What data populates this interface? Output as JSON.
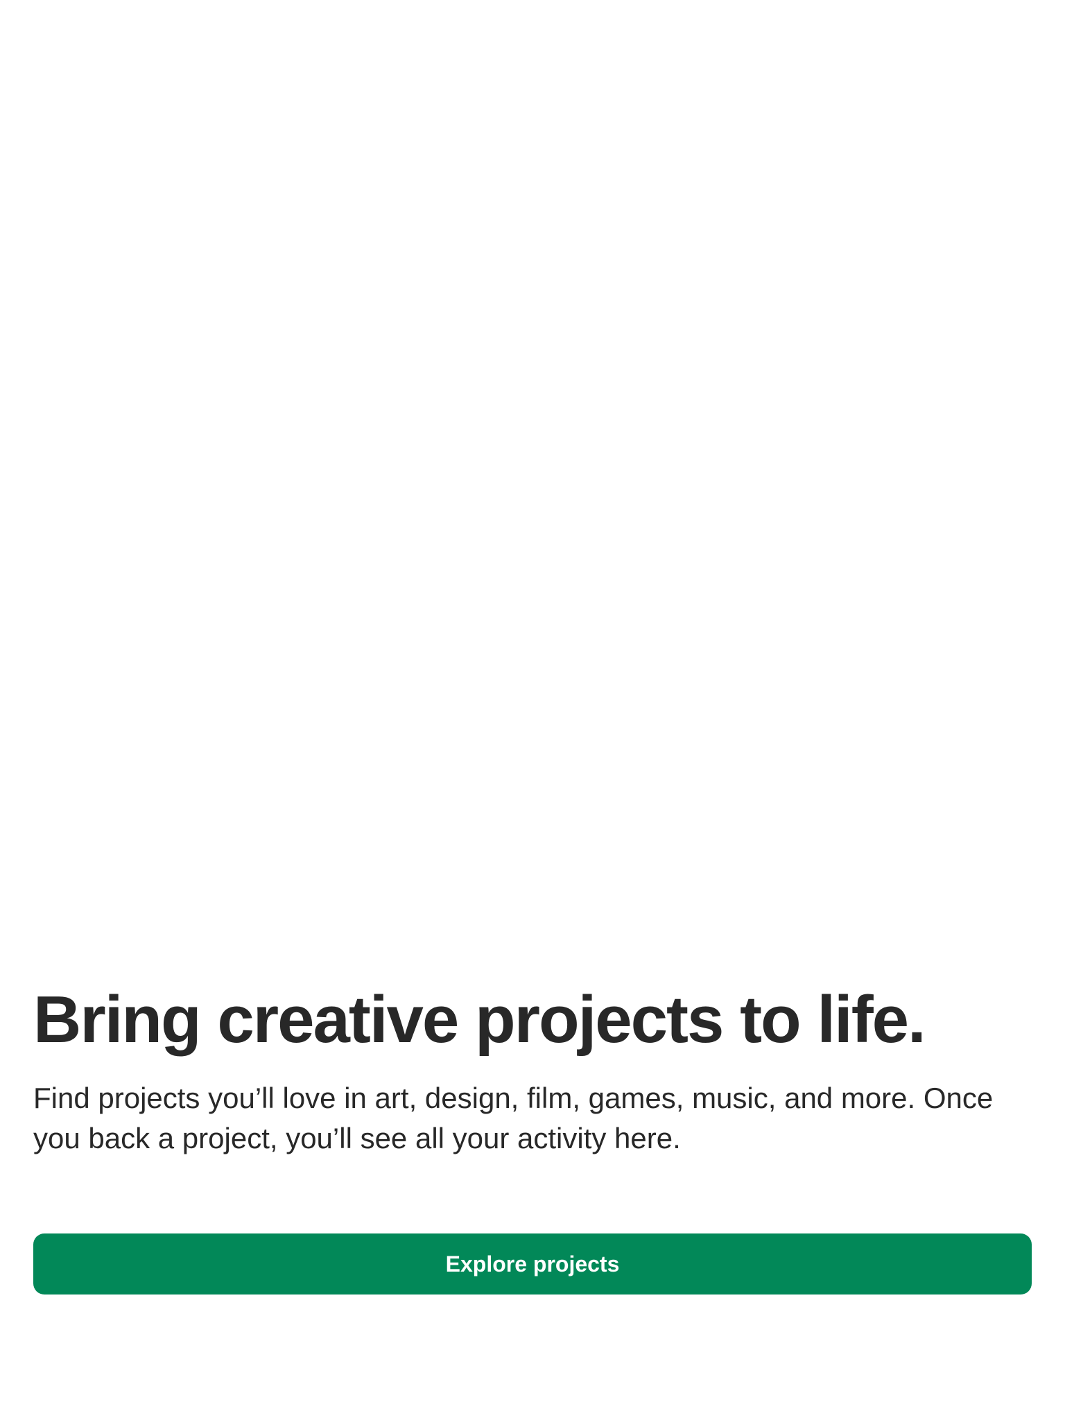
{
  "empty_state": {
    "headline": "Bring creative projects to life.",
    "description": "Find projects you’ll love in art, design, film, games, music, and more. Once you back a project, you’ll see all your activity here.",
    "cta_label": "Explore projects"
  },
  "colors": {
    "background": "#ffffff",
    "text": "#282828",
    "accent_green": "#028858",
    "button_text": "#ffffff"
  }
}
